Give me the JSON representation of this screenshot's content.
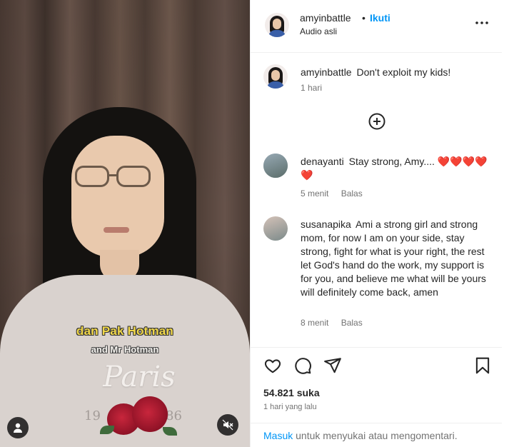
{
  "video": {
    "caption_primary": "dan Pak Hotman",
    "caption_secondary": "and Mr Hotman",
    "shirt_text": "Paris",
    "shirt_year_left": "19",
    "shirt_year_right": "86",
    "icons": {
      "profile": "user-icon",
      "sound": "sound-off-icon"
    }
  },
  "post": {
    "username": "amyinbattle",
    "separator": "•",
    "follow_label": "Ikuti",
    "audio_label": "Audio asli",
    "caption": "Don't exploit my kids!",
    "caption_time": "1 hari",
    "likes": "54.821 suka",
    "time_ago": "1 hari yang lalu"
  },
  "comments": [
    {
      "username": "denayanti",
      "text": "Stay strong, Amy.... ❤️❤️❤️❤️❤️",
      "time": "5 menit",
      "reply_label": "Balas"
    },
    {
      "username": "susanapika",
      "text": "Ami a strong girl and strong mom, for now I am on your side, stay strong, fight for what is your right, the rest let God's hand do the work, my support is for you, and believe me what will be yours will definitely come back, amen",
      "time": "8 menit",
      "reply_label": "Balas"
    }
  ],
  "login_prompt": {
    "link": "Masuk",
    "text": "untuk menyukai atau mengomentari."
  },
  "colors": {
    "accent": "#0095f6",
    "caption_yellow": "#f1d84a",
    "muted": "#737373",
    "heart_red": "#e0243b"
  }
}
